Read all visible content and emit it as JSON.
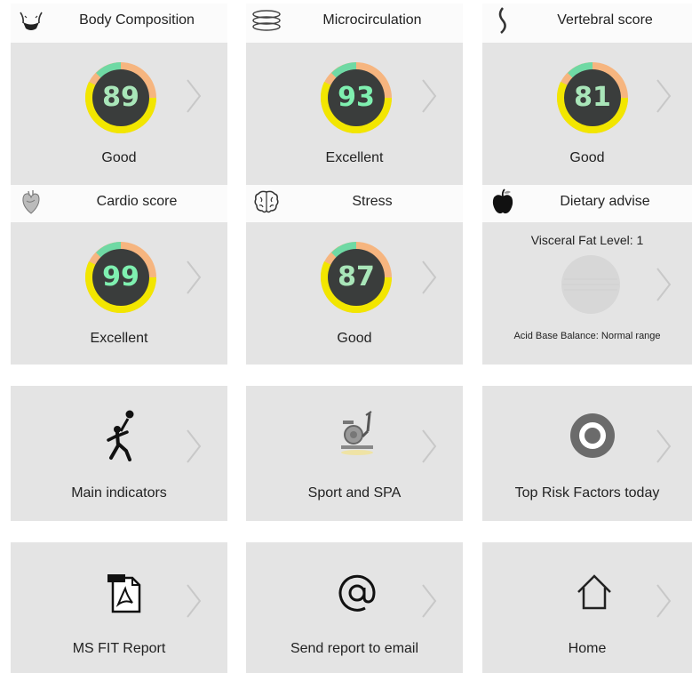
{
  "colors": {
    "card_bg": "#e4e4e4",
    "header_bg": "#fbfbfb",
    "gauge_center": "#3a3d3c",
    "gauge_number": "#a9e6b9",
    "gauge_number_bright": "#7ff0b0",
    "ring_yellow": "#f2e600",
    "ring_orange": "#f6b57f",
    "ring_green": "#6fd9a4",
    "chevron": "#c8c8c8"
  },
  "health_cards": [
    {
      "title": "Body Composition",
      "icon": "body-silhouette-icon",
      "score": "89",
      "status": "Good"
    },
    {
      "title": "Microcirculation",
      "icon": "vessels-icon",
      "score": "93",
      "status": "Excellent"
    },
    {
      "title": "Vertebral score",
      "icon": "spine-icon",
      "score": "81",
      "status": "Good"
    },
    {
      "title": "Cardio score",
      "icon": "heart-icon",
      "score": "99",
      "status": "Excellent"
    },
    {
      "title": "Stress",
      "icon": "brain-icon",
      "score": "87",
      "status": "Good"
    }
  ],
  "dietary_card": {
    "title": "Dietary advise",
    "icon": "apple-icon",
    "visceral_fat": "Visceral Fat Level: 1",
    "acid_base": "Acid Base Balance: Normal range"
  },
  "nav_tiles": [
    {
      "label": "Main indicators",
      "icon": "running-person-icon"
    },
    {
      "label": "Sport and SPA",
      "icon": "exercise-bike-icon"
    },
    {
      "label": "Top Risk Factors today",
      "icon": "target-icon"
    },
    {
      "label": "MS FIT Report",
      "icon": "pdf-document-icon"
    },
    {
      "label": "Send report to email",
      "icon": "at-sign-icon"
    },
    {
      "label": "Home",
      "icon": "home-icon"
    }
  ]
}
